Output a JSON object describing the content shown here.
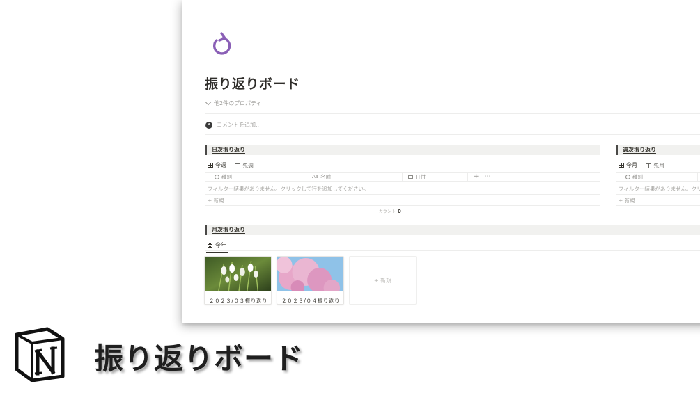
{
  "page": {
    "title": "振り返りボード",
    "properties_toggle": "他2件のプロパティ",
    "comment_placeholder": "コメントを追加..."
  },
  "sections": {
    "daily": {
      "title": "日次振り返り",
      "tabs": [
        "今週",
        "先週"
      ],
      "columns": [
        "種別",
        "名前",
        "日付"
      ],
      "column_icons": [
        "circle-icon",
        "text-aa-icon",
        "calendar-icon"
      ],
      "empty_text": "フィルター結果がありません。クリックして行を追加してください。",
      "new_label": "新規",
      "count_label": "カウント",
      "count_value": "0"
    },
    "weekly": {
      "title": "週次振り返り",
      "tabs": [
        "今月",
        "先月"
      ],
      "columns": [
        "種別"
      ],
      "empty_text": "フィルター結果がありません。クリッ",
      "new_label": "新規"
    },
    "monthly": {
      "title": "月次振り返り",
      "tabs": [
        "今年"
      ],
      "cards": [
        {
          "label": "２０２３/０３振り返り",
          "image": "snowdrop-flowers-image"
        },
        {
          "label": "２０２３/０４振り返り",
          "image": "cherry-blossom-image"
        }
      ],
      "new_label": "新規"
    }
  },
  "brand": {
    "logo": "notion-logo",
    "title": "振り返りボード"
  },
  "colors": {
    "accent_purple": "#8a5fb6",
    "text": "#37352f",
    "muted": "#9b9a97"
  }
}
